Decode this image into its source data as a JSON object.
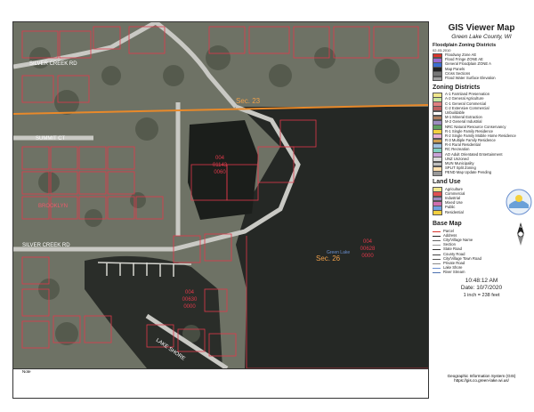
{
  "panel": {
    "title": "GIS Viewer Map",
    "subtitle": "Green Lake County, WI",
    "floodplain": {
      "heading": "Floodplain Zoning Districts",
      "date": "02-03-2010",
      "items": [
        {
          "label": "Floodway Zone AE",
          "color": "#d9342b"
        },
        {
          "label": "Flood Fringe ZONE AE",
          "color": "#9b6ad1"
        },
        {
          "label": "General Floodplain ZONE A",
          "color": "#3c6fd0"
        },
        {
          "label": "Map Panels",
          "color": "#222222"
        },
        {
          "label": "Cross Sections",
          "color": "#777777"
        },
        {
          "label": "Flood Water Surface Elevation",
          "color": "#a0a0a0"
        }
      ]
    },
    "zoning": {
      "heading": "Zoning Districts",
      "items": [
        {
          "label": "A-1 Farmland Preservation",
          "color": "#f0e68c"
        },
        {
          "label": "A-2 General Agriculture",
          "color": "#c8e6a0"
        },
        {
          "label": "C-1 General Commercial",
          "color": "#e08080"
        },
        {
          "label": "C-2 Extensive Commercial",
          "color": "#c06060"
        },
        {
          "label": "Unbuildable",
          "color": "#ffffff"
        },
        {
          "label": "M-1 Mineral Extraction",
          "color": "#b08060"
        },
        {
          "label": "M-2 General Industrial",
          "color": "#9c8cc0"
        },
        {
          "label": "NRC Natural Resource Conservancy",
          "color": "#60a060"
        },
        {
          "label": "R-1 Single Family Residence",
          "color": "#f4d03f"
        },
        {
          "label": "R-2 Single Family Mobile Home Residence",
          "color": "#e6b0d0"
        },
        {
          "label": "R-3 Multiple Family Residence",
          "color": "#d0a050"
        },
        {
          "label": "R-4 Rural Residential",
          "color": "#a0c0e0"
        },
        {
          "label": "RC Recreation",
          "color": "#80d0c0"
        },
        {
          "label": "AO Adult Orientated Entertainment",
          "color": "#c9a3d8"
        },
        {
          "label": "UNZ Unzoned",
          "color": "#dddddd"
        },
        {
          "label": "MUN Municipality",
          "color": "#c0c0c0"
        },
        {
          "label": "SPLIT Split Zoning",
          "color": "#ffe0b0"
        },
        {
          "label": "PEND Map Update Pending",
          "color": "#999999"
        }
      ]
    },
    "landuse": {
      "heading": "Land Use",
      "items": [
        {
          "label": "Agriculture",
          "color": "#f0e68c"
        },
        {
          "label": "Commercial",
          "color": "#e05050"
        },
        {
          "label": "Industrial",
          "color": "#9c8cc0"
        },
        {
          "label": "Mixed Use",
          "color": "#d070b0"
        },
        {
          "label": "Public",
          "color": "#70a0e0"
        },
        {
          "label": "Residential",
          "color": "#f4d03f"
        }
      ]
    },
    "basemap": {
      "heading": "Base Map",
      "items": [
        {
          "label": "Parcel",
          "color": "#d9342b"
        },
        {
          "label": "Address",
          "color": "#222222"
        },
        {
          "label": "City/Village Name",
          "color": "#666666"
        },
        {
          "label": "Section",
          "color": "#999999"
        },
        {
          "label": "State Road",
          "color": "#333333"
        },
        {
          "label": "County Road",
          "color": "#444444"
        },
        {
          "label": "City/Village Town Road",
          "color": "#555555"
        },
        {
          "label": "Private Road",
          "color": "#888888"
        },
        {
          "label": "Lake Shore",
          "color": "#6a8fd0"
        },
        {
          "label": "River Stream",
          "color": "#4a6fb0"
        }
      ]
    },
    "time": "10:48:12 AM",
    "date": "Date: 10/7/2020",
    "scale": "1 inch = 238 feet"
  },
  "footer": {
    "line1": "Geographic Information System (GIS)",
    "line2": "https://gis.co.green-lake.wi.us/"
  },
  "note": {
    "label": "Note"
  },
  "map": {
    "roads": [
      "SILVER CREEK RD",
      "SUMMIT CT",
      "SILVER CREEK RD",
      "LAKE SHORE"
    ],
    "sections": [
      "Sec. 23",
      "Sec. 26"
    ],
    "place": "BROOKLYN",
    "lake": "Green Lake",
    "parcels": [
      {
        "a": "004",
        "b": "01143",
        "c": "0060"
      },
      {
        "a": "004",
        "b": "00628",
        "c": "0000"
      },
      {
        "a": "004",
        "b": "00630",
        "c": "0000"
      }
    ],
    "compass": "N"
  }
}
